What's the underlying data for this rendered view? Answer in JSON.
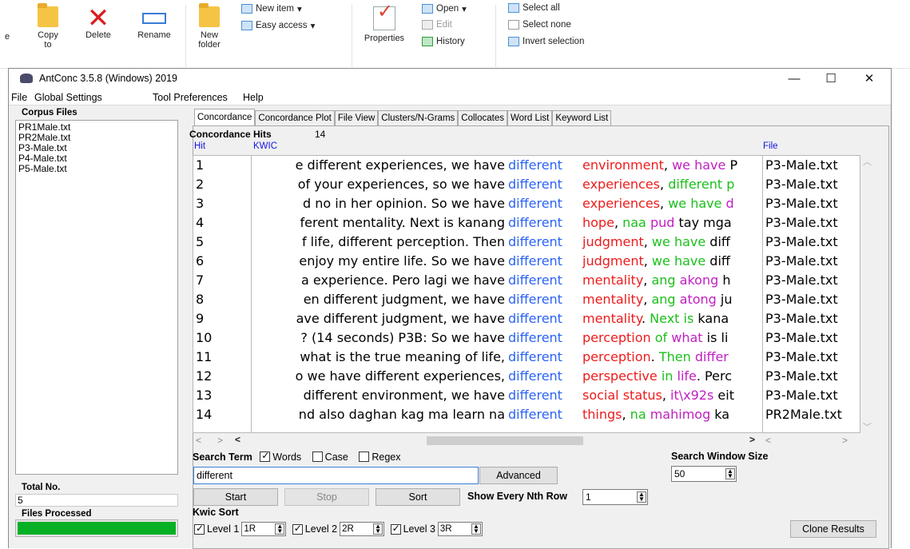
{
  "ribbon": {
    "copy_to": "Copy\nto",
    "delete": "Delete",
    "rename": "Rename",
    "new_folder": "New\nfolder",
    "new_item": "New item",
    "easy_access": "Easy access",
    "properties": "Properties",
    "open": "Open",
    "edit": "Edit",
    "history": "History",
    "select_all": "Select all",
    "select_none": "Select none",
    "invert_selection": "Invert selection"
  },
  "window": {
    "title": "AntConc 3.5.8 (Windows) 2019",
    "minimize": "—",
    "maximize": "☐",
    "close": "✕"
  },
  "menu": [
    "File",
    "Global Settings",
    "Tool Preferences",
    "Help"
  ],
  "left": {
    "corpus_files_label": "Corpus Files",
    "files": [
      "PR1Male.txt",
      "PR2Male.txt",
      "P3-Male.txt",
      "P4-Male.txt",
      "P5-Male.txt"
    ],
    "total_no_label": "Total No.",
    "total_no": "5",
    "files_processed_label": "Files Processed",
    "progress": 1.0
  },
  "tabs": [
    "Concordance",
    "Concordance Plot",
    "File View",
    "Clusters/N-Grams",
    "Collocates",
    "Word List",
    "Keyword List"
  ],
  "concordance": {
    "hits_label": "Concordance Hits",
    "hits": "14",
    "col_hit": "Hit",
    "col_kwic": "KWIC",
    "col_file": "File",
    "rows": [
      {
        "hit": "1",
        "left": "e different experiences, we have",
        "key": "different",
        "right": [
          [
            "environment",
            "red"
          ],
          [
            ", ",
            "blk"
          ],
          [
            "we have",
            "mag"
          ],
          [
            " P",
            "blk"
          ]
        ],
        "file": "P3-Male.txt"
      },
      {
        "hit": "2",
        "left": "of your experiences, so we have",
        "key": "different",
        "right": [
          [
            "experiences",
            "red"
          ],
          [
            ", ",
            "blk"
          ],
          [
            "different p",
            "green"
          ]
        ],
        "file": "P3-Male.txt"
      },
      {
        "hit": "3",
        "left": "d no in her opinion. So we have",
        "key": "different",
        "right": [
          [
            "experiences",
            "red"
          ],
          [
            ", ",
            "blk"
          ],
          [
            "we have",
            "green"
          ],
          [
            " d",
            "mag"
          ]
        ],
        "file": "P3-Male.txt"
      },
      {
        "hit": "4",
        "left": "ferent mentality. Next is kanang",
        "key": "different",
        "right": [
          [
            "hope",
            "red"
          ],
          [
            ", ",
            "blk"
          ],
          [
            "naa",
            "green"
          ],
          [
            " pud",
            "mag"
          ],
          [
            " tay mga",
            "blk"
          ]
        ],
        "file": "P3-Male.txt"
      },
      {
        "hit": "5",
        "left": "f life, different perception. Then",
        "key": "different",
        "right": [
          [
            "judgment",
            "red"
          ],
          [
            ", ",
            "blk"
          ],
          [
            "we have",
            "green"
          ],
          [
            " diff",
            "blk"
          ]
        ],
        "file": "P3-Male.txt"
      },
      {
        "hit": "6",
        "left": "enjoy my entire life. So we have",
        "key": "different",
        "right": [
          [
            "judgment",
            "red"
          ],
          [
            ", ",
            "blk"
          ],
          [
            "we have",
            "green"
          ],
          [
            " diff",
            "blk"
          ]
        ],
        "file": "P3-Male.txt"
      },
      {
        "hit": "7",
        "left": "a experience. Pero lagi we have",
        "key": "different",
        "right": [
          [
            "mentality",
            "red"
          ],
          [
            ", ",
            "blk"
          ],
          [
            "ang",
            "green"
          ],
          [
            " akong",
            "mag"
          ],
          [
            " h",
            "blk"
          ]
        ],
        "file": "P3-Male.txt"
      },
      {
        "hit": "8",
        "left": "en different judgment, we have",
        "key": "different",
        "right": [
          [
            "mentality",
            "red"
          ],
          [
            ", ",
            "blk"
          ],
          [
            "ang",
            "green"
          ],
          [
            " atong",
            "mag"
          ],
          [
            " ju",
            "blk"
          ]
        ],
        "file": "P3-Male.txt"
      },
      {
        "hit": "9",
        "left": "ave different judgment, we have",
        "key": "different",
        "right": [
          [
            "mentality",
            "red"
          ],
          [
            ". ",
            "blk"
          ],
          [
            "Next is",
            "green"
          ],
          [
            " kana",
            "blk"
          ]
        ],
        "file": "P3-Male.txt"
      },
      {
        "hit": "10",
        "left": "? (14 seconds) P3B: So we have",
        "key": "different",
        "right": [
          [
            "perception",
            "red"
          ],
          [
            " of",
            "green"
          ],
          [
            " what",
            "mag"
          ],
          [
            " is li",
            "blk"
          ]
        ],
        "file": "P3-Male.txt"
      },
      {
        "hit": "11",
        "left": "what is the true meaning of life,",
        "key": "different",
        "right": [
          [
            "perception",
            "red"
          ],
          [
            ". ",
            "blk"
          ],
          [
            "Then",
            "green"
          ],
          [
            " differ",
            "mag"
          ]
        ],
        "file": "P3-Male.txt"
      },
      {
        "hit": "12",
        "left": "o we have different experiences,",
        "key": "different",
        "right": [
          [
            "perspective",
            "red"
          ],
          [
            " in",
            "green"
          ],
          [
            " life",
            "mag"
          ],
          [
            ". Perc",
            "blk"
          ]
        ],
        "file": "P3-Male.txt"
      },
      {
        "hit": "13",
        "left": "different environment, we have",
        "key": "different",
        "right": [
          [
            "social",
            "red"
          ],
          [
            " status",
            "red"
          ],
          [
            ", ",
            "blk"
          ],
          [
            "it\\x92s",
            "mag"
          ],
          [
            " eit",
            "blk"
          ]
        ],
        "file": "P3-Male.txt"
      },
      {
        "hit": "14",
        "left": "nd also daghan kag ma learn na",
        "key": "different",
        "right": [
          [
            "things",
            "red"
          ],
          [
            ", ",
            "blk"
          ],
          [
            "na",
            "green"
          ],
          [
            " mahimog",
            "mag"
          ],
          [
            " ka",
            "blk"
          ]
        ],
        "file": "PR2Male.txt"
      }
    ]
  },
  "search": {
    "term_label": "Search Term",
    "words": "Words",
    "case": "Case",
    "regex": "Regex",
    "value": "different",
    "advanced": "Advanced",
    "window_size_label": "Search Window Size",
    "window_size": "50",
    "start": "Start",
    "stop": "Stop",
    "sort": "Sort",
    "nth_label": "Show Every Nth Row",
    "nth_value": "1"
  },
  "kwic_sort": {
    "label": "Kwic Sort",
    "levels": [
      {
        "label": "Level 1",
        "value": "1R"
      },
      {
        "label": "Level 2",
        "value": "2R"
      },
      {
        "label": "Level 3",
        "value": "3R"
      }
    ],
    "clone_results": "Clone Results"
  },
  "colors": {
    "keyword": "#2a62f5",
    "red": "#ee1b1b",
    "green": "#1bbf1b",
    "magenta": "#c020c0",
    "progress": "#06b025"
  }
}
